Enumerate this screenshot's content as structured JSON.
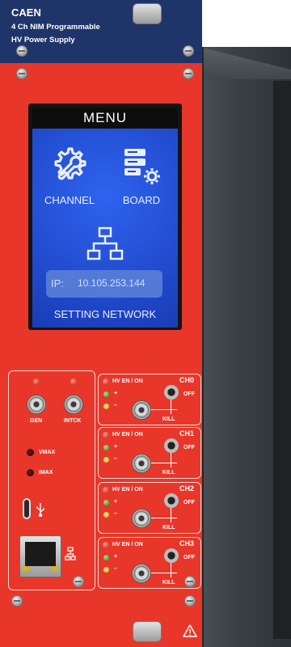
{
  "header": {
    "brand": "CAEN",
    "line1": "4 Ch NIM Programmable",
    "line2": "HV Power Supply"
  },
  "screen": {
    "title": "MENU",
    "items": [
      {
        "label": "CHANNEL",
        "icon": "wrench-gear-icon"
      },
      {
        "label": "BOARD",
        "icon": "server-gear-icon"
      },
      {
        "label": "SETTING NETWORK",
        "icon": "network-icon"
      }
    ],
    "ip_label": "IP:",
    "ip_value": "10.105.253.144"
  },
  "left_panel": {
    "gen_label": "GEN",
    "intck_label": "INTCK",
    "vmax_label": "VMAX",
    "imax_label": "IMAX"
  },
  "channels": [
    {
      "name": "CH0",
      "hv_label": "HV EN / ON",
      "off_label": "OFF",
      "kill_label": "KILL",
      "plus": "+",
      "minus": "–"
    },
    {
      "name": "CH1",
      "hv_label": "HV EN / ON",
      "off_label": "OFF",
      "kill_label": "KILL",
      "plus": "+",
      "minus": "–"
    },
    {
      "name": "CH2",
      "hv_label": "HV EN / ON",
      "off_label": "OFF",
      "kill_label": "KILL",
      "plus": "+",
      "minus": "–"
    },
    {
      "name": "CH3",
      "hv_label": "HV EN / ON",
      "off_label": "OFF",
      "kill_label": "KILL",
      "plus": "+",
      "minus": "–"
    }
  ],
  "colors": {
    "panel_red": "#e8372a",
    "header_blue": "#1f3468",
    "screen_blue": "#2350d8"
  }
}
